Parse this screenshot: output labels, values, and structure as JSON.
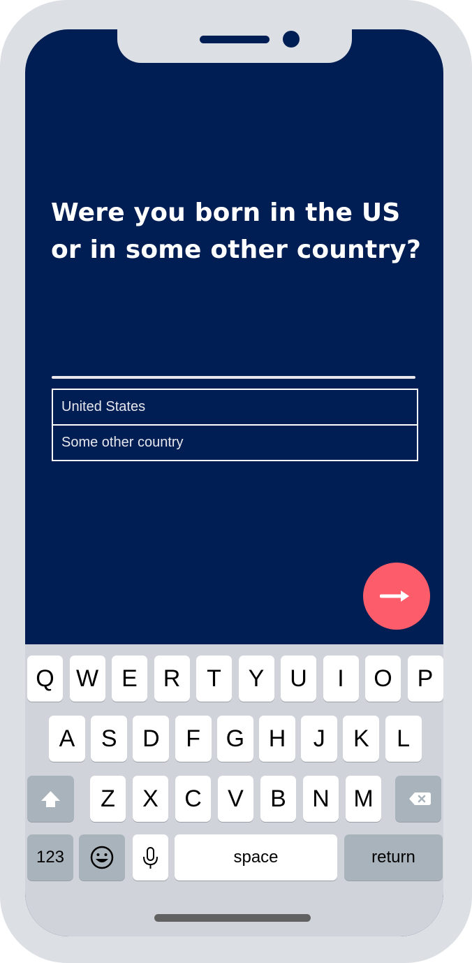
{
  "question": {
    "line1": "Were you born in the US",
    "line2": "or in some other country?"
  },
  "options": [
    "United States",
    "Some other country"
  ],
  "next_button": {
    "icon": "arrow-right-icon",
    "color": "#fd5c6a"
  },
  "keyboard": {
    "row1": [
      "Q",
      "W",
      "E",
      "R",
      "T",
      "Y",
      "U",
      "I",
      "O",
      "P"
    ],
    "row2": [
      "A",
      "S",
      "D",
      "F",
      "G",
      "H",
      "J",
      "K",
      "L"
    ],
    "row3": [
      "Z",
      "X",
      "C",
      "V",
      "B",
      "N",
      "M"
    ],
    "shift_icon": "shift-icon",
    "delete_icon": "delete-icon",
    "numbers_label": "123",
    "emoji_icon": "emoji-icon",
    "mic_icon": "microphone-icon",
    "space_label": "space",
    "return_label": "return"
  },
  "colors": {
    "background": "#001e53",
    "frame": "#dcdfe4",
    "accent": "#fd5c6a"
  }
}
